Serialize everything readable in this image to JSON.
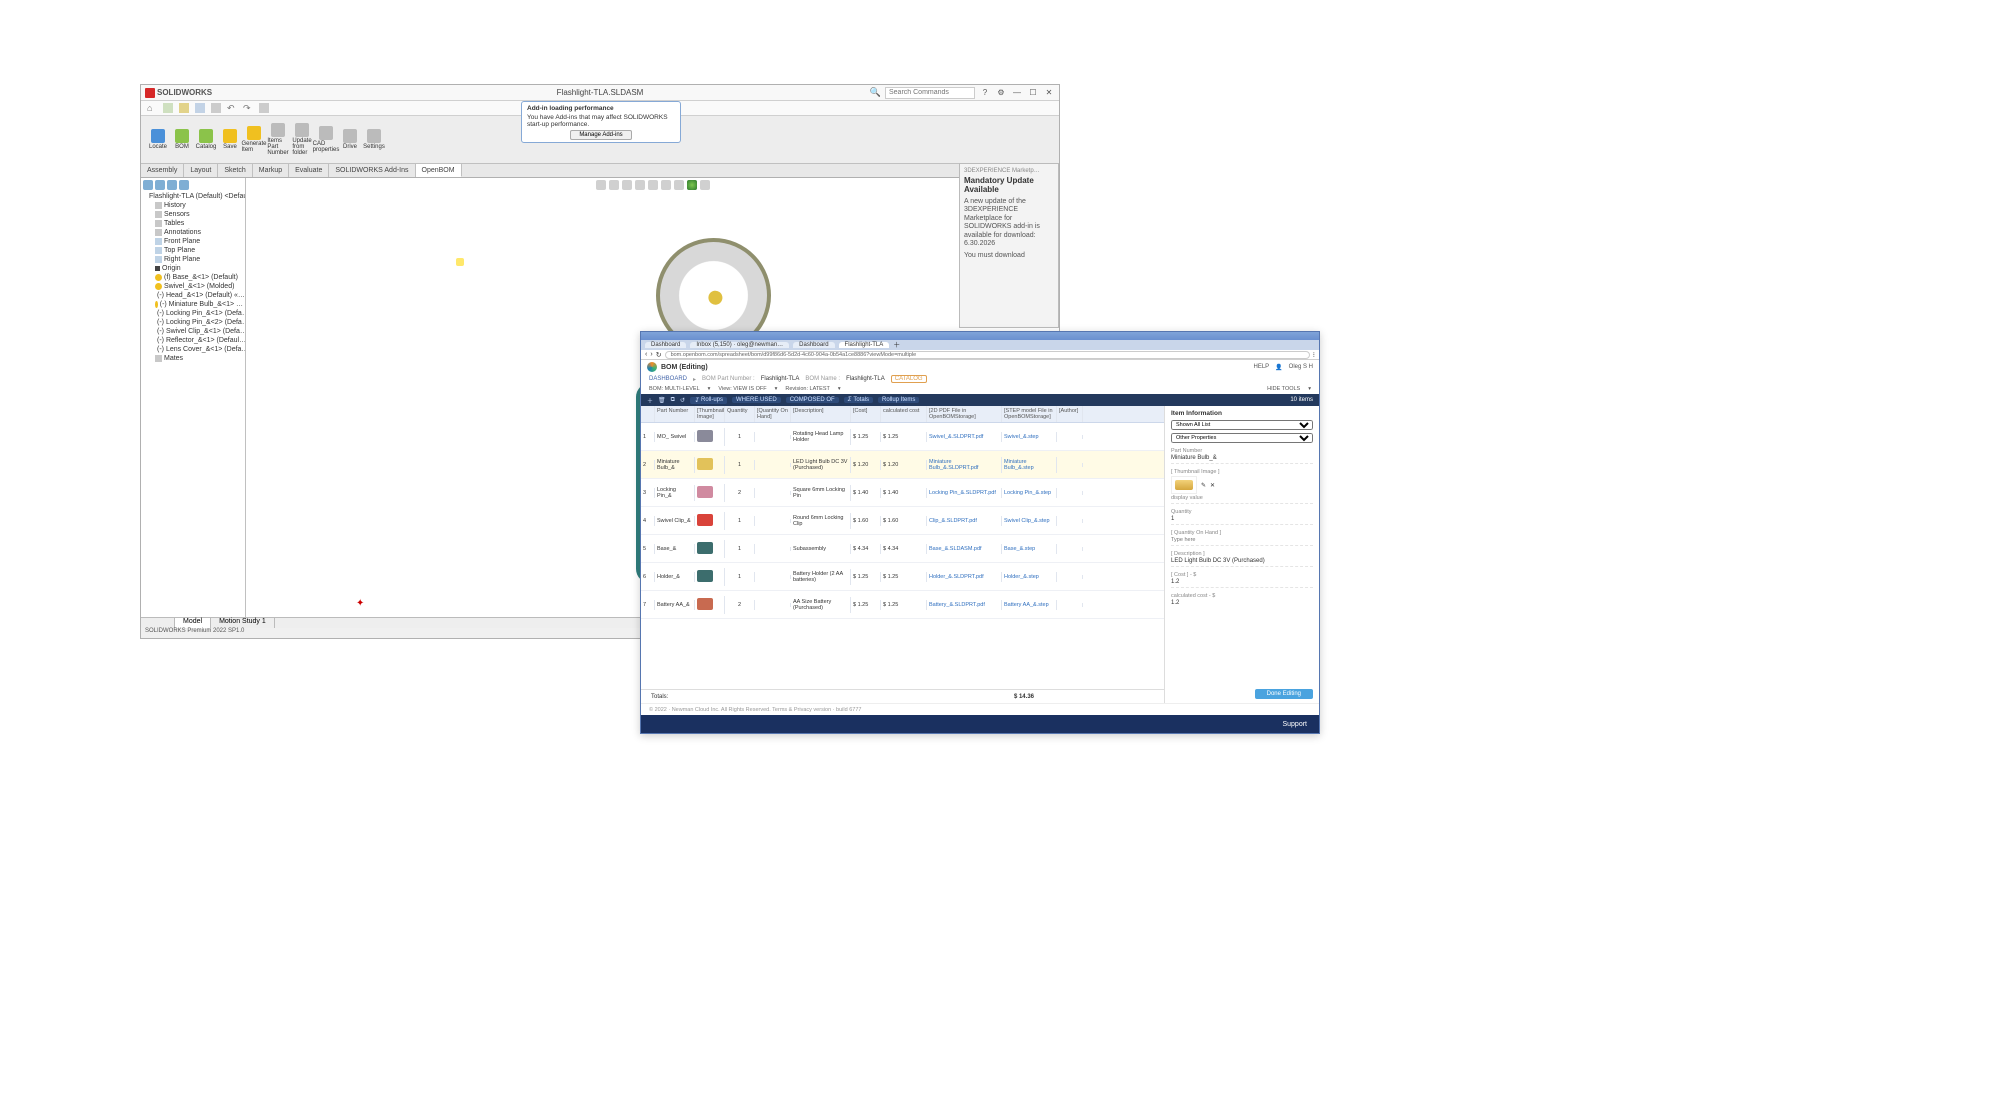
{
  "solidworks": {
    "brand": "SOLIDWORKS",
    "doc_title": "Flashlight-TLA.SLDASM",
    "search_placeholder": "Search Commands",
    "quick_tool_count": 8,
    "ribbon": [
      {
        "label": "Locate",
        "cls": "sw-ico-blue"
      },
      {
        "label": "BOM",
        "cls": "sw-ico-green"
      },
      {
        "label": "Catalog",
        "cls": "sw-ico-green"
      },
      {
        "label": "Save",
        "cls": "sw-ico-yellow"
      },
      {
        "label": "Generate\nItem",
        "cls": "sw-ico-yellow"
      },
      {
        "label": "Items\nPart\nNumber",
        "cls": "sw-ico-grey"
      },
      {
        "label": "Update\nfrom\nfolder",
        "cls": "sw-ico-grey"
      },
      {
        "label": "CAD\nproperties",
        "cls": "sw-ico-grey"
      },
      {
        "label": "Drive",
        "cls": "sw-ico-grey"
      },
      {
        "label": "Settings",
        "cls": "sw-ico-grey"
      }
    ],
    "tabs": [
      "Assembly",
      "Layout",
      "Sketch",
      "Markup",
      "Evaluate",
      "SOLIDWORKS Add-Ins",
      "OpenBOM"
    ],
    "tab_active": 6,
    "notice": {
      "title": "Add-in loading performance",
      "body": "You have Add-ins that may affect SOLIDWORKS start-up performance.",
      "button": "Manage Add-ins"
    },
    "tree": {
      "root": "Flashlight-TLA (Default) <Defau…",
      "nodes": [
        {
          "icon": "sw-ni-folder",
          "label": "History"
        },
        {
          "icon": "sw-ni-folder",
          "label": "Sensors"
        },
        {
          "icon": "sw-ni-folder",
          "label": "Tables"
        },
        {
          "icon": "sw-ni-folder",
          "label": "Annotations"
        },
        {
          "icon": "sw-ni-plane",
          "label": "Front Plane"
        },
        {
          "icon": "sw-ni-plane",
          "label": "Top Plane"
        },
        {
          "icon": "sw-ni-plane",
          "label": "Right Plane"
        },
        {
          "icon": "sw-ni-origin",
          "label": "Origin"
        },
        {
          "icon": "sw-ni-part",
          "label": "(f) Base_&<1> (Default) <D…"
        },
        {
          "icon": "sw-ni-part",
          "label": "Swivel_&<1> (Molded) <D…"
        },
        {
          "icon": "sw-ni-part",
          "label": "(-) Head_&<1> (Default) «…"
        },
        {
          "icon": "sw-ni-part",
          "label": "(-) Miniature Bulb_&<1> …"
        },
        {
          "icon": "sw-ni-part",
          "label": "(-) Locking Pin_&<1> (Defa…"
        },
        {
          "icon": "sw-ni-part",
          "label": "(-) Locking Pin_&<2> (Defa…"
        },
        {
          "icon": "sw-ni-part",
          "label": "(-) Swivel Clip_&<1> (Defa…"
        },
        {
          "icon": "sw-ni-part",
          "label": "(-) Reflector_&<1> (Defaul…"
        },
        {
          "icon": "sw-ni-part",
          "label": "(-) Lens Cover_&<1> (Defa…"
        },
        {
          "icon": "sw-ni-folder",
          "label": "Mates"
        }
      ]
    },
    "sidepanel": {
      "tab": "3DEXPERIENCE Marketp…",
      "title": "Mandatory Update Available",
      "body": "A new update of the 3DEXPERIENCE Marketplace for SOLIDWORKS add-in is available for download: 6.30.2026",
      "note": "You must download"
    },
    "bottom_tabs": {
      "active": 0,
      "labels": [
        "Model",
        "Motion Study 1"
      ]
    },
    "status": "SOLIDWORKS Premium 2022 SP1.0"
  },
  "openbom": {
    "tabs": [
      "Dashboard",
      "Inbox (5,150) · oleg@newman…",
      "Dashboard",
      "Flashlight-TLA"
    ],
    "tab_active": 3,
    "url": "bom.openbom.com/spreadsheet/bom/d99f86d6-5d2d-4c60-904a-0b54a1ce8886?viewMode=multiple",
    "app": "BOM (Editing)",
    "help": "HELP",
    "user": "Oleg S H",
    "hide_tools": "HIDE TOOLS",
    "breadcrumb": {
      "home": "DASHBOARD",
      "pn_label": "BOM Part Number :",
      "pn": "Flashlight-TLA",
      "name_label": "BOM Name :",
      "name": "Flashlight-TLA",
      "catalog": "CATALOG"
    },
    "toolbar": {
      "bom": "BOM: MULTI-LEVEL",
      "view": "View: VIEW IS OFF",
      "rev": "Revision: LATEST"
    },
    "actionbar": {
      "rollup": "Roll-ups",
      "where": "WHERE USED",
      "composed": "COMPOSED OF",
      "totals": "Totals",
      "rollupitems": "Rollup Items",
      "count": "10 items"
    },
    "headers": [
      "",
      "Part Number",
      "[Thumbnail Image]",
      "Quantity",
      "[Quantity On Hand]",
      "[Description]",
      "[Cost]",
      "calculated cost",
      "[2D PDF File in OpenBOMStorage]",
      "[STEP model File in OpenBOMStorage]",
      "[Author]"
    ],
    "rows": [
      {
        "n": "1",
        "pn": "MO_ Swivel",
        "thumb": "#8a8a9a",
        "qty": "1",
        "qoh": "",
        "desc": "Rotating Head Lamp Holder",
        "cost": "$ 1.25",
        "calc": "$ 1.25",
        "pdf": "Swivel_&.SLDPRT.pdf",
        "step": "Swivel_&.step"
      },
      {
        "n": "2",
        "pn": "Miniature Bulb_&",
        "thumb": "#e2c25a",
        "qty": "1",
        "qoh": "",
        "desc": "LED Light Bulb DC 3V (Purchased)",
        "cost": "$ 1.20",
        "calc": "$ 1.20",
        "pdf": "Miniature Bulb_&.SLDPRT.pdf",
        "step": "Miniature Bulb_&.step"
      },
      {
        "n": "3",
        "pn": "Locking Pin_&",
        "thumb": "#d08aa0",
        "qty": "2",
        "qoh": "",
        "desc": "Square 6mm Locking Pin",
        "cost": "$ 1.40",
        "calc": "$ 1.40",
        "pdf": "Locking Pin_&.SLDPRT.pdf",
        "step": "Locking Pin_&.step"
      },
      {
        "n": "4",
        "pn": "Swivel Clip_&",
        "thumb": "#d9433a",
        "qty": "1",
        "qoh": "",
        "desc": "Round 6mm Locking Clip",
        "cost": "$ 1.60",
        "calc": "$ 1.60",
        "pdf": "Clip_&.SLDPRT.pdf",
        "step": "Swivel Clip_&.step"
      },
      {
        "n": "5",
        "pn": "Base_&",
        "thumb": "#3c6d6d",
        "qty": "1",
        "qoh": "",
        "desc": "Subassembly",
        "cost": "$ 4.34",
        "calc": "$ 4.34",
        "pdf": "Base_&.SLDASM.pdf",
        "step": "Base_&.step"
      },
      {
        "n": "6",
        "pn": "Holder_&",
        "thumb": "#3c6d6d",
        "qty": "1",
        "qoh": "",
        "desc": "Battery Holder (2 AA batteries)",
        "cost": "$ 1.25",
        "calc": "$ 1.25",
        "pdf": "Holder_&.SLDPRT.pdf",
        "step": "Holder_&.step"
      },
      {
        "n": "7",
        "pn": "Battery AA_&",
        "thumb": "#c86a50",
        "qty": "2",
        "qoh": "",
        "desc": "AA Size Battery (Purchased)",
        "cost": "$ 1.25",
        "calc": "$ 1.25",
        "pdf": "Battery_&.SLDPRT.pdf",
        "step": "Battery AA_&.step"
      }
    ],
    "totals": {
      "label": "Totals:",
      "value": "$ 14.36"
    },
    "item_panel": {
      "title": "Item Information",
      "group": "Shown All List",
      "other": "Other Properties",
      "part_number_label": "Part Number",
      "part_number": "Miniature Bulb_&",
      "thumb_label": "[ Thumbnail Image ]",
      "thumb_caption": "display value",
      "qty_label": "Quantity",
      "qty": "1",
      "qoh_label": "[ Quantity On Hand ]",
      "qoh_hint": "Type here",
      "desc_label": "[ Description ]",
      "desc": "LED Light Bulb DC 3V (Purchased)",
      "cost_label": "[ Cost ] - $",
      "cost": "1.2",
      "calc_label": "calculated cost - $",
      "calc": "1.2",
      "done": "Done Editing"
    },
    "footer": "© 2022 · Newman Cloud Inc. All Rights Reserved.  Terms & Privacy   version · build 6777",
    "support": "Support"
  }
}
